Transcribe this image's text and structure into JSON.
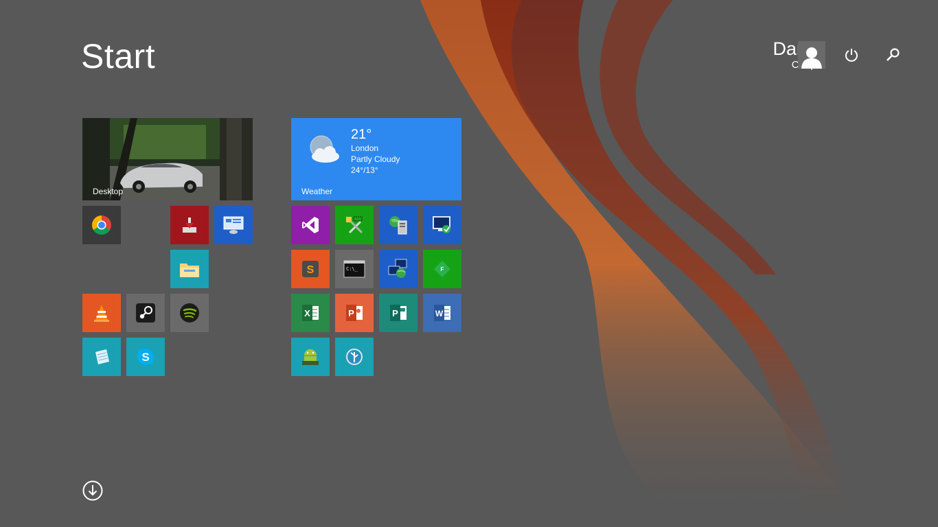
{
  "header": {
    "title": "Start"
  },
  "user": {
    "first_name": "Daniel",
    "last_name": "Cooper"
  },
  "tiles": {
    "desktop": {
      "label": "Desktop"
    },
    "weather": {
      "label": "Weather",
      "temperature": "21°",
      "city": "London",
      "condition": "Partly Cloudy",
      "range": "24°/13°"
    }
  },
  "icons": {
    "chrome": "chrome-icon",
    "app_installer": "installer-icon",
    "remote_desktop": "remote-desktop-icon",
    "file_explorer": "file-explorer-icon",
    "vlc": "vlc-icon",
    "steam": "steam-icon",
    "spotify": "spotify-icon",
    "notepad": "notepad-icon",
    "skype": "skype-icon",
    "visual_studio": "visual-studio-icon",
    "dev_tools": "dev-tools-icon",
    "server_manager": "server-manager-icon",
    "remote_connection": "remote-connection-icon",
    "sublime": "sublime-icon",
    "cmd": "command-prompt-icon",
    "network": "network-icon",
    "feedly": "feedly-icon",
    "excel": "excel-icon",
    "powerpoint": "powerpoint-icon",
    "publisher": "publisher-icon",
    "word": "word-icon",
    "android_studio": "android-studio-icon",
    "sourcetree": "sourcetree-icon"
  },
  "tile_glyphs": {
    "excel": "X",
    "powerpoint": "P",
    "publisher": "P",
    "word": "W",
    "sublime": "S",
    "cmd": "C:\\_",
    "feedly": "F"
  },
  "colors": {
    "background": "#585858",
    "accent_red": "#c0471b",
    "accent_blue": "#2d89ef",
    "tile_green": "#15a315",
    "tile_purple": "#8f1fa8",
    "tile_teal": "#1ba1b4"
  }
}
